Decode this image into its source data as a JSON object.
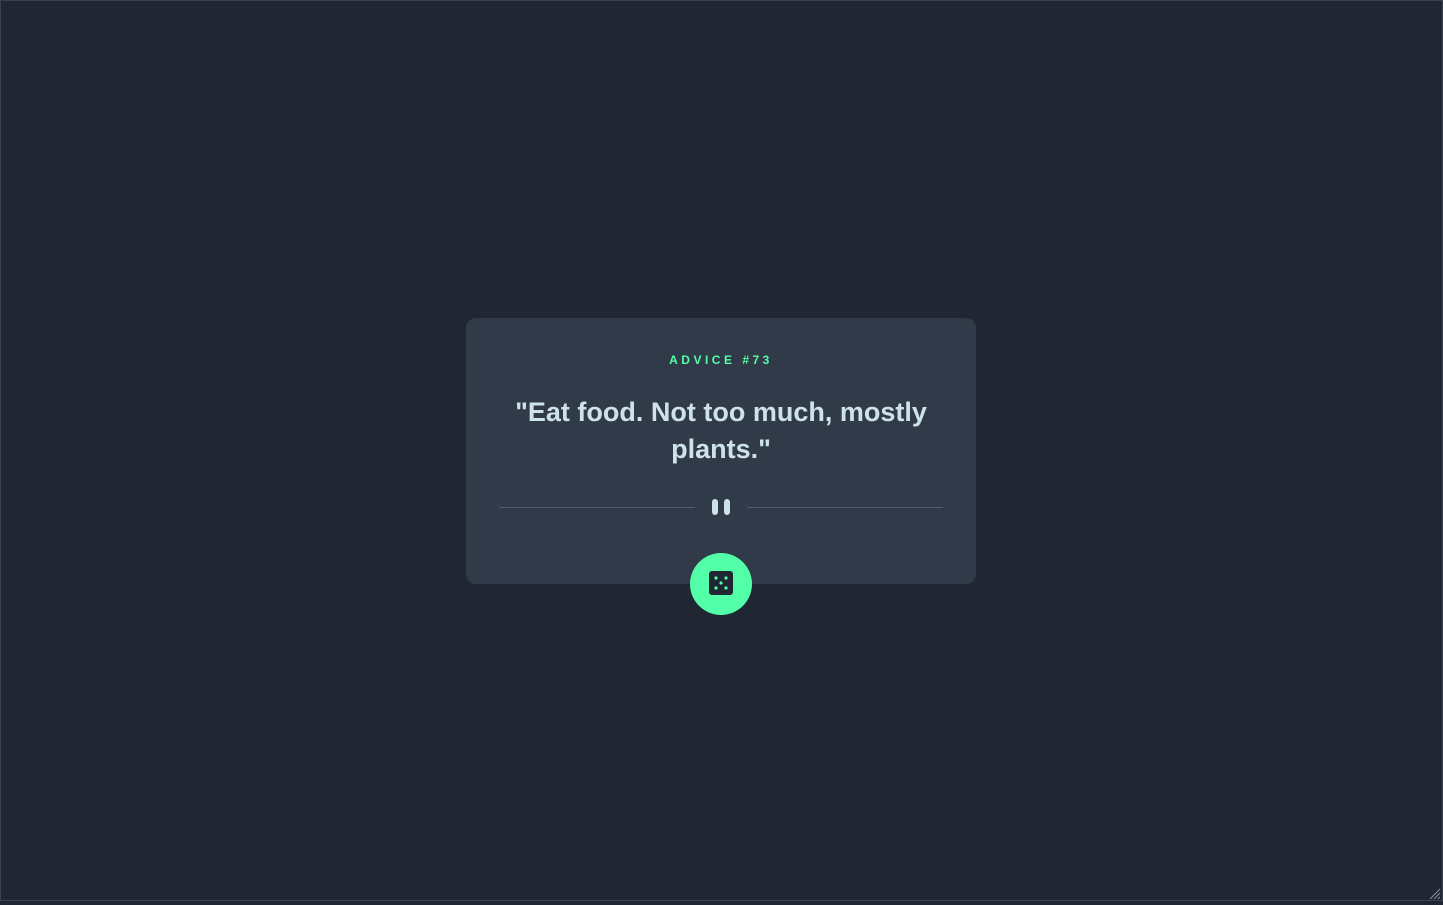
{
  "card": {
    "advice_id": "ADVICE #73",
    "advice_text": "\"Eat food. Not too much, mostly plants.\""
  },
  "colors": {
    "background": "#202733",
    "card": "#313a48",
    "accent": "#52ffa8",
    "text": "#cee3e9",
    "divider": "#4f5d74"
  },
  "icons": {
    "divider": "pause-icon",
    "button": "dice-icon"
  }
}
